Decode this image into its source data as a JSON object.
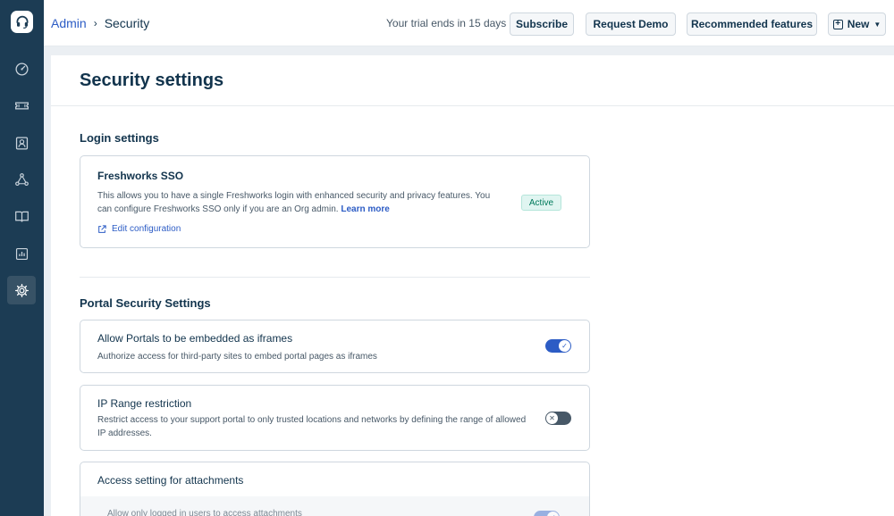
{
  "header": {
    "breadcrumb": {
      "parent": "Admin",
      "separator": "›",
      "current": "Security"
    },
    "trial_text": "Your trial ends in 15 days",
    "buttons": {
      "subscribe": "Subscribe",
      "request_demo": "Request Demo",
      "recommended": "Recommended features",
      "new": "New"
    }
  },
  "sidebar": {
    "items": [
      {
        "icon": "dashboard-icon",
        "active": false
      },
      {
        "icon": "ticket-icon",
        "active": false
      },
      {
        "icon": "contacts-icon",
        "active": false
      },
      {
        "icon": "social-icon",
        "active": false
      },
      {
        "icon": "knowledge-base-icon",
        "active": false
      },
      {
        "icon": "reports-icon",
        "active": false
      },
      {
        "icon": "admin-gear-icon",
        "active": true
      }
    ]
  },
  "page": {
    "title": "Security settings"
  },
  "login_settings": {
    "title": "Login settings",
    "sso": {
      "title": "Freshworks SSO",
      "description": "This allows you to have a single Freshworks login with enhanced security and privacy features. You can configure Freshworks SSO only if you are an Org admin.",
      "learn_more": "Learn more",
      "edit_link": "Edit configuration",
      "status": "Active"
    }
  },
  "portal_security": {
    "title": "Portal Security Settings",
    "iframes": {
      "title": "Allow Portals to be embedded as iframes",
      "description": "Authorize access for third-party sites to embed portal pages as iframes",
      "enabled": true
    },
    "ip_range": {
      "title": "IP Range restriction",
      "description": "Restrict access to your support portal to only trusted locations and networks by defining the range of allowed IP addresses.",
      "enabled": false
    },
    "attachments": {
      "title": "Access setting for attachments",
      "sub_option": "Allow only logged in users to access attachments",
      "enabled": true
    }
  },
  "colors": {
    "sidebar": "#1c3c54",
    "accent": "#2c5cc5",
    "active_badge": "#00795b"
  }
}
